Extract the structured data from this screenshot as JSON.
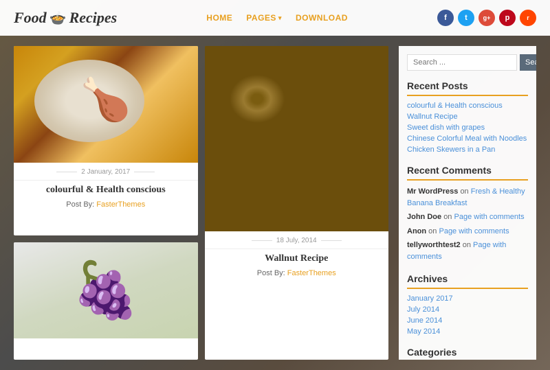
{
  "header": {
    "logo_text": "Food",
    "logo_separator": "Recipes",
    "nav": [
      {
        "label": "HOME",
        "active": true
      },
      {
        "label": "PAGES",
        "dropdown": true
      },
      {
        "label": "DOWNLOAD"
      }
    ],
    "social": [
      {
        "name": "facebook",
        "letter": "f"
      },
      {
        "name": "twitter",
        "letter": "t"
      },
      {
        "name": "google-plus",
        "letter": "g+"
      },
      {
        "name": "pinterest",
        "letter": "p"
      },
      {
        "name": "reddit",
        "letter": "r"
      }
    ]
  },
  "posts": [
    {
      "id": "chicken",
      "date": "2 January, 2017",
      "title": "colourful & Health conscious",
      "author_label": "Post By:",
      "author": "FasterThemes",
      "image_type": "chicken"
    },
    {
      "id": "walnuts",
      "date": "18 July, 2014",
      "title": "Wallnut Recipe",
      "author_label": "Post By:",
      "author": "FasterThemes",
      "image_type": "walnuts",
      "tall": true
    },
    {
      "id": "grapes",
      "image_type": "grapes"
    },
    {
      "id": "noodles",
      "date": "",
      "title": "",
      "image_type": "noodles",
      "partial": true
    }
  ],
  "sidebar": {
    "search_placeholder": "Search ...",
    "search_button": "Search",
    "recent_posts_title": "Recent Posts",
    "recent_posts": [
      "colourful & Health conscious",
      "Wallnut Recipe",
      "Sweet dish with grapes",
      "Chinese Colorful Meal with Noodles",
      "Chicken Skewers in a Pan"
    ],
    "recent_comments_title": "Recent Comments",
    "recent_comments": [
      {
        "user": "Mr WordPress",
        "action": "on",
        "link": "Fresh & Healthy Banana Breakfast"
      },
      {
        "user": "John Doe",
        "action": "on",
        "link": "Page with comments"
      },
      {
        "user": "Anon",
        "action": "on",
        "link": "Page with comments"
      },
      {
        "user": "tellyworthtest2",
        "action": "on",
        "link": "Page with comments"
      }
    ],
    "archives_title": "Archives",
    "archives": [
      "January 2017",
      "July 2014",
      "June 2014",
      "May 2014"
    ],
    "categories_title": "Categories"
  }
}
